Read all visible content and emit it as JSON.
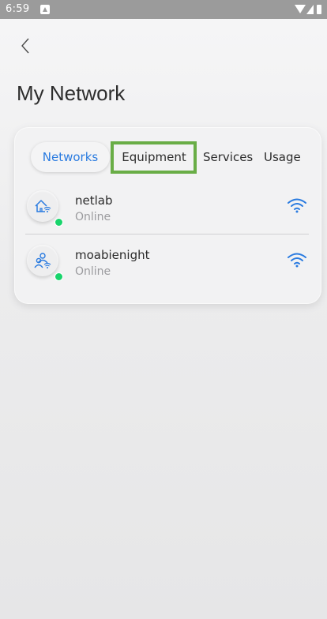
{
  "status_bar": {
    "time": "6:59"
  },
  "page": {
    "title": "My Network"
  },
  "tabs": [
    {
      "label": "Networks",
      "selected": true
    },
    {
      "label": "Equipment",
      "selected": false,
      "highlighted": true
    },
    {
      "label": "Services",
      "selected": false
    },
    {
      "label": "Usage",
      "selected": false
    }
  ],
  "networks": [
    {
      "name": "netlab",
      "status": "Online",
      "icon": "home-wifi-icon",
      "signal_icon": "wifi-signal-icon"
    },
    {
      "name": "moabienight",
      "status": "Online",
      "icon": "users-wifi-icon",
      "signal_icon": "wifi-signal-icon"
    }
  ],
  "colors": {
    "accent": "#2a7be0",
    "online": "#19d46c",
    "highlight": "#69ad46",
    "status_bar": "#9b9b9b"
  }
}
